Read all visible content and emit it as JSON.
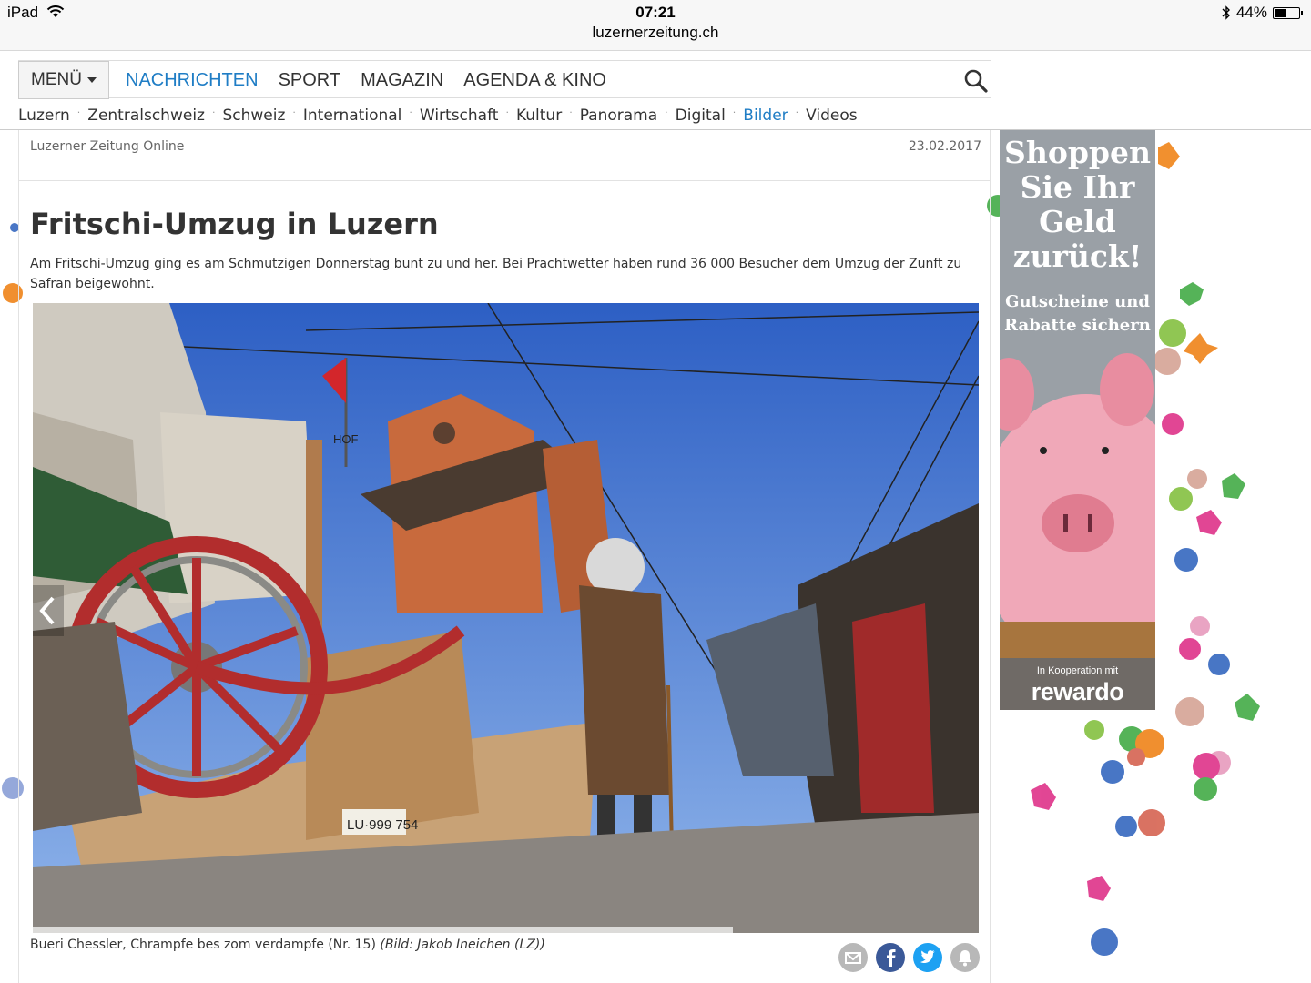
{
  "status_bar": {
    "device": "iPad",
    "time": "07:21",
    "url": "luzernerzeitung.ch",
    "battery": "44%",
    "battery_level": 0.44
  },
  "main_nav": {
    "menu_label": "MENÜ",
    "items": [
      {
        "label": "NACHRICHTEN",
        "active": true
      },
      {
        "label": "SPORT",
        "active": false
      },
      {
        "label": "MAGAZIN",
        "active": false
      },
      {
        "label": "AGENDA & KINO",
        "active": false
      }
    ],
    "search_icon": "search-icon"
  },
  "sub_nav": {
    "items": [
      {
        "label": "Luzern",
        "active": false
      },
      {
        "label": "Zentralschweiz",
        "active": false
      },
      {
        "label": "Schweiz",
        "active": false
      },
      {
        "label": "International",
        "active": false
      },
      {
        "label": "Wirtschaft",
        "active": false
      },
      {
        "label": "Kultur",
        "active": false
      },
      {
        "label": "Panorama",
        "active": false
      },
      {
        "label": "Digital",
        "active": false
      },
      {
        "label": "Bilder",
        "active": true
      },
      {
        "label": "Videos",
        "active": false
      }
    ],
    "separator": "·"
  },
  "article": {
    "source": "Luzerner Zeitung Online",
    "date": "23.02.2017",
    "title": "Fritschi-Umzug in Luzern",
    "lead": "Am Fritschi-Umzug ging es am Schmutzigen Donnerstag bunt zu und her. Bei Prachtwetter haben rund 36 000 Besucher dem Umzug der Zunft zu Safran beigewohnt.",
    "image_plate": "LU·999 754",
    "image_sign": "HOF",
    "caption": "Bueri Chessler, Chrampfe bes zom verdampfe (Nr. 15)",
    "credit": "(Bild: Jakob Ineichen (LZ))",
    "gallery_progress": 0.74
  },
  "share_buttons": [
    {
      "name": "email-share-button",
      "icon": "email-icon",
      "color": "#b8b8b8"
    },
    {
      "name": "facebook-share-button",
      "icon": "facebook-icon",
      "color": "#3b5998"
    },
    {
      "name": "twitter-share-button",
      "icon": "twitter-icon",
      "color": "#1da1f2"
    },
    {
      "name": "notification-button",
      "icon": "bell-icon",
      "color": "#b8b8b8"
    }
  ],
  "ad": {
    "headline": "Shoppen Sie Ihr Geld zurück!",
    "subline": "Gutscheine und Rabatte sichern",
    "cooperation": "In Kooperation mit",
    "brand": "rewardo"
  },
  "colors": {
    "accent": "#1f7dc5",
    "text": "#333333",
    "ad_background": "#9aa0a6",
    "confetti": [
      "#e03d8f",
      "#4caf50",
      "#f08a24",
      "#3f6fc2",
      "#d8a89a",
      "#8bc34a"
    ]
  }
}
